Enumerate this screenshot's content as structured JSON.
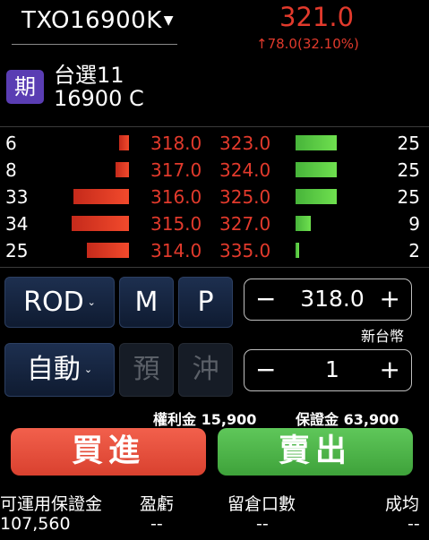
{
  "header": {
    "symbol": "TXO16900K",
    "symbol_caret": "▼",
    "price": "321.0",
    "change": "↑78.0(32.10%)",
    "badge": "期",
    "name": "台選11",
    "strike": "16900 C"
  },
  "colors": {
    "up": "#e23a2c",
    "bid_bar": "#e8432a",
    "ask_bar": "#5fd646",
    "badge": "#5a3db3"
  },
  "order_book": [
    {
      "bid_qty": "6",
      "bid_price": "318.0",
      "ask_price": "323.0",
      "ask_qty": "25"
    },
    {
      "bid_qty": "8",
      "bid_price": "317.0",
      "ask_price": "324.0",
      "ask_qty": "25"
    },
    {
      "bid_qty": "33",
      "bid_price": "316.0",
      "ask_price": "325.0",
      "ask_qty": "25"
    },
    {
      "bid_qty": "34",
      "bid_price": "315.0",
      "ask_price": "327.0",
      "ask_qty": "9"
    },
    {
      "bid_qty": "25",
      "bid_price": "314.0",
      "ask_price": "335.0",
      "ask_qty": "2"
    }
  ],
  "controls": {
    "order_type": "ROD",
    "order_type_caret": "⌄",
    "m_label": "M",
    "p_label": "P",
    "price_minus": "−",
    "price_value": "318.0",
    "price_plus": "+",
    "currency": "新台幣",
    "mode": "自動",
    "mode_caret": "⌄",
    "preset_label": "預",
    "offset_label": "沖",
    "qty_minus": "−",
    "qty_value": "1",
    "qty_plus": "+"
  },
  "margin": {
    "premium_label": "權利金",
    "premium_value": "15,900",
    "margin_label": "保證金",
    "margin_value": "63,900"
  },
  "actions": {
    "buy": "買進",
    "sell": "賣出"
  },
  "footer": {
    "available_label": "可運用保證金",
    "available_value": "107,560",
    "pnl_label": "盈虧",
    "pnl_value": "--",
    "position_label": "留倉口數",
    "position_value": "--",
    "avg_label": "成均",
    "avg_value": "--"
  }
}
